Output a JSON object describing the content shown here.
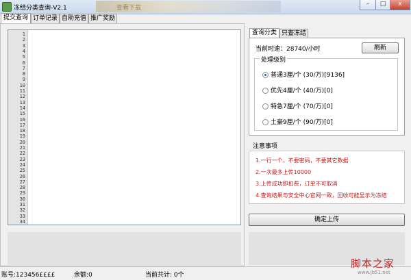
{
  "window": {
    "title": "冻结分类查询-V2.1",
    "banner_text": "查看下载",
    "minimize": "–",
    "maximize": "□",
    "close": "x"
  },
  "tabs": [
    "提交查询",
    "订单记录",
    "自助充值",
    "推广奖励"
  ],
  "editor": {
    "line_numbers": [
      "1",
      "2",
      "3",
      "4",
      "5",
      "6",
      "7",
      "8",
      "9",
      "10",
      "11",
      "12",
      "13",
      "14",
      "15",
      "16",
      "17",
      "18",
      "19",
      "20",
      "21",
      "22",
      "23",
      "24",
      "25",
      "26",
      "27",
      "28",
      "29",
      "30",
      "31",
      "32",
      "33",
      "34"
    ]
  },
  "right_tabs": [
    "查询分类",
    "只查冻结"
  ],
  "speed_label": "当前时速：28740/小时",
  "refresh_label": "刷新",
  "level_group": {
    "label": "处理级别",
    "options": [
      {
        "label": "普通3厘/个 (30/万)[9136]",
        "selected": true
      },
      {
        "label": "优先4厘/个 (40/万)[0]",
        "selected": false
      },
      {
        "label": "特急7厘/个 (70/万)[0]",
        "selected": false
      },
      {
        "label": "土豪9厘/个 (90/万)[0]",
        "selected": false
      }
    ]
  },
  "notes": {
    "title": "注意事项",
    "items": [
      "1.一行一个，不要密码，不要其它数据",
      "2.一次最多上传10000",
      "3.上传成功即扣费，订单不可取消",
      "4.查询结果与安全中心官网一致，回收可能显示为冻结"
    ]
  },
  "confirm_label": "确定上传",
  "status": {
    "account": "账号:123456££££",
    "balance": "余额:0",
    "today_total": "当前共计: 0个"
  },
  "watermark": {
    "text": "脚本之家",
    "url": "www.jb51.net"
  },
  "colors": {
    "accent_red": "#cc1a1a",
    "selected_radio": "#2a5cb8"
  }
}
